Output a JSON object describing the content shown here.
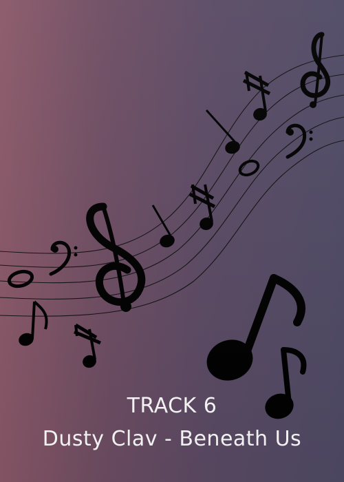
{
  "cover": {
    "track_label": "TRACK 6",
    "track_title": "Dusty Clav - Beneath Us",
    "background_colors": [
      "#8a5868",
      "#6e4d63",
      "#5b4a64",
      "#4f4a65"
    ],
    "text_color": "#ffffff",
    "art_color": "#000000"
  },
  "icons": {
    "staff": "music-staff-wave",
    "notes": [
      "treble-clef-icon",
      "bass-clef-icon",
      "eighth-note-icon",
      "beamed-sixteenth-notes-icon",
      "quarter-note-icon",
      "whole-note-icon",
      "beamed-eighth-notes-icon"
    ]
  }
}
